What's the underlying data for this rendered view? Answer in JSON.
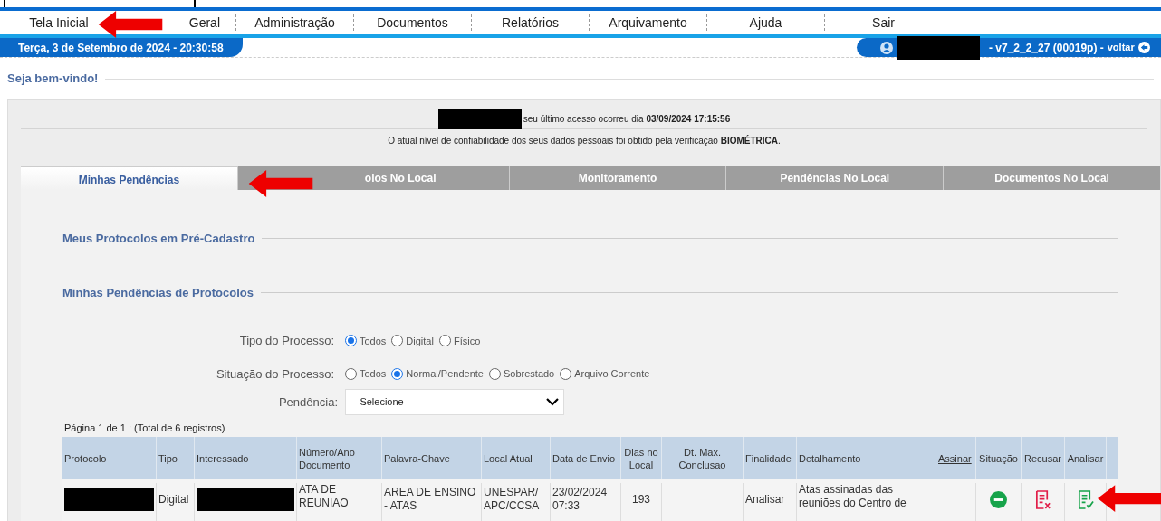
{
  "menu": [
    {
      "label": "Tela Inicial"
    },
    {
      "label": "Geral"
    },
    {
      "label": "Administração"
    },
    {
      "label": "Documentos"
    },
    {
      "label": "Relatórios"
    },
    {
      "label": "Arquivamento"
    },
    {
      "label": "Ajuda"
    },
    {
      "label": "Sair"
    }
  ],
  "date": "Terça, 3 de Setembro de 2024 - 20:30:58",
  "user_version": "- v7_2_2_27 (00019p) -",
  "back_link": "voltar",
  "welcome": "Seja bem-vindo!",
  "last_access": "seu último acesso ocorreu dia **03/09/2024 17:15:56**",
  "reliability": "O atual nível de confiabilidade dos seus dados pessoais foi obtido pela verificação **BIOMÉTRICA**.",
  "tabs": [
    {
      "label": "Minhas Pendências",
      "selected": true
    },
    {
      "label": "olos No Local",
      "selected": false
    },
    {
      "label": "Monitoramento",
      "selected": false
    },
    {
      "label": "Pendências No Local",
      "selected": false
    },
    {
      "label": "Documentos No Local",
      "selected": false
    }
  ],
  "sections": [
    "Meus Protocolos em Pré-Cadastro",
    "Minhas Pendências de Protocolos"
  ],
  "filters": [
    {
      "label": "Tipo do Processo:",
      "options": [
        {
          "label": "Todos",
          "selected": true
        },
        {
          "label": "Digital",
          "selected": false
        },
        {
          "label": "Físico",
          "selected": false
        }
      ]
    },
    {
      "label": "Situação do Processo:",
      "options": [
        {
          "label": "Todos",
          "selected": false
        },
        {
          "label": "Normal/Pendente",
          "selected": true
        },
        {
          "label": "Sobrestado",
          "selected": false
        },
        {
          "label": "Arquivo Corrente",
          "selected": false
        }
      ]
    }
  ],
  "pendencia": {
    "label": "Pendência:",
    "value": "-- Selecione --"
  },
  "pagination": "Página 1 de 1 : (Total de 6 registros)",
  "table": {
    "columns": [
      {
        "label": "Protocolo",
        "link": false
      },
      {
        "label": "Tipo",
        "link": false
      },
      {
        "label": "Interessado",
        "link": false
      },
      {
        "label": "Número/Ano Documento",
        "link": false
      },
      {
        "label": "Palavra-Chave",
        "link": false
      },
      {
        "label": "Local Atual",
        "link": false
      },
      {
        "label": "Data de Envio",
        "link": false
      },
      {
        "label": "Dias no Local",
        "link": false
      },
      {
        "label": "Dt. Max. Conclusao",
        "link": false
      },
      {
        "label": "Finalidade",
        "link": false
      },
      {
        "label": "Detalhamento",
        "link": false
      },
      {
        "label": "Assinar",
        "link": true
      },
      {
        "label": "Situação",
        "link": false
      },
      {
        "label": "Recusar",
        "link": false
      },
      {
        "label": "Analisar",
        "link": false
      }
    ],
    "rows": [
      {
        "cells": [
          {
            "kind": "redacted"
          },
          {
            "kind": "text",
            "text": "Digital"
          },
          {
            "kind": "redacted"
          },
          {
            "kind": "text",
            "text": "ATA DE REUNIAO"
          },
          {
            "kind": "text",
            "text": "AREA DE ENSINO - ATAS"
          },
          {
            "kind": "text",
            "text": "UNESPAR/ APC/CCSA"
          },
          {
            "kind": "text",
            "text": "23/02/2024 07:33"
          },
          {
            "kind": "text",
            "text": "193"
          },
          {
            "kind": "empty"
          },
          {
            "kind": "text",
            "text": "Analisar"
          },
          {
            "kind": "text",
            "text": "Atas assinadas das reuniões do Centro de"
          },
          {
            "kind": "empty"
          },
          {
            "kind": "status"
          },
          {
            "kind": "refuse"
          },
          {
            "kind": "analyze"
          }
        ]
      }
    ]
  }
}
